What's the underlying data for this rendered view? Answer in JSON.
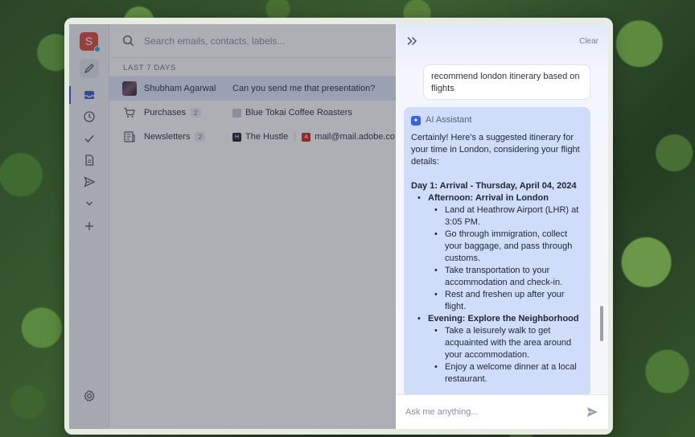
{
  "search": {
    "placeholder": "Search emails, contacts, labels..."
  },
  "list": {
    "section_label": "LAST 7 DAYS",
    "rows": [
      {
        "name": "Shubham Agarwal",
        "subject": "Can you send me that presentation?"
      },
      {
        "name": "Purchases",
        "count": "2",
        "sender": "Blue Tokai Coffee Roasters"
      },
      {
        "name": "Newsletters",
        "count": "2",
        "sender": "The Hustle",
        "sender2": "mail@mail.adobe.co"
      }
    ]
  },
  "rail": {
    "avatar_letter": "S"
  },
  "assistant": {
    "clear_label": "Clear",
    "user_message": "recommend london itinerary based on flights",
    "ai_name": "AI Assistant",
    "intro": "Certainly! Here's a suggested itinerary for your time in London, considering your flight details:",
    "day1": "Day 1: Arrival - Thursday, April 04, 2024",
    "afternoon_heading": "Afternoon: Arrival in London",
    "afternoon_items": [
      "Land at Heathrow Airport (LHR) at 3:05 PM.",
      "Go through immigration, collect your baggage, and pass through customs.",
      "Take transportation to your accommodation and check-in.",
      "Rest and freshen up after your flight."
    ],
    "evening_heading": "Evening: Explore the Neighborhood",
    "evening_items": [
      "Take a leisurely walk to get acquainted with the area around your accommodation.",
      "Enjoy a welcome dinner at a local restaurant."
    ],
    "input_placeholder": "Ask me anything..."
  },
  "colors": {
    "accent": "#3b63d9",
    "avatar": "#e0473e",
    "ai_bubble": "#cfdcfa",
    "active_row": "#e3e8fb"
  }
}
